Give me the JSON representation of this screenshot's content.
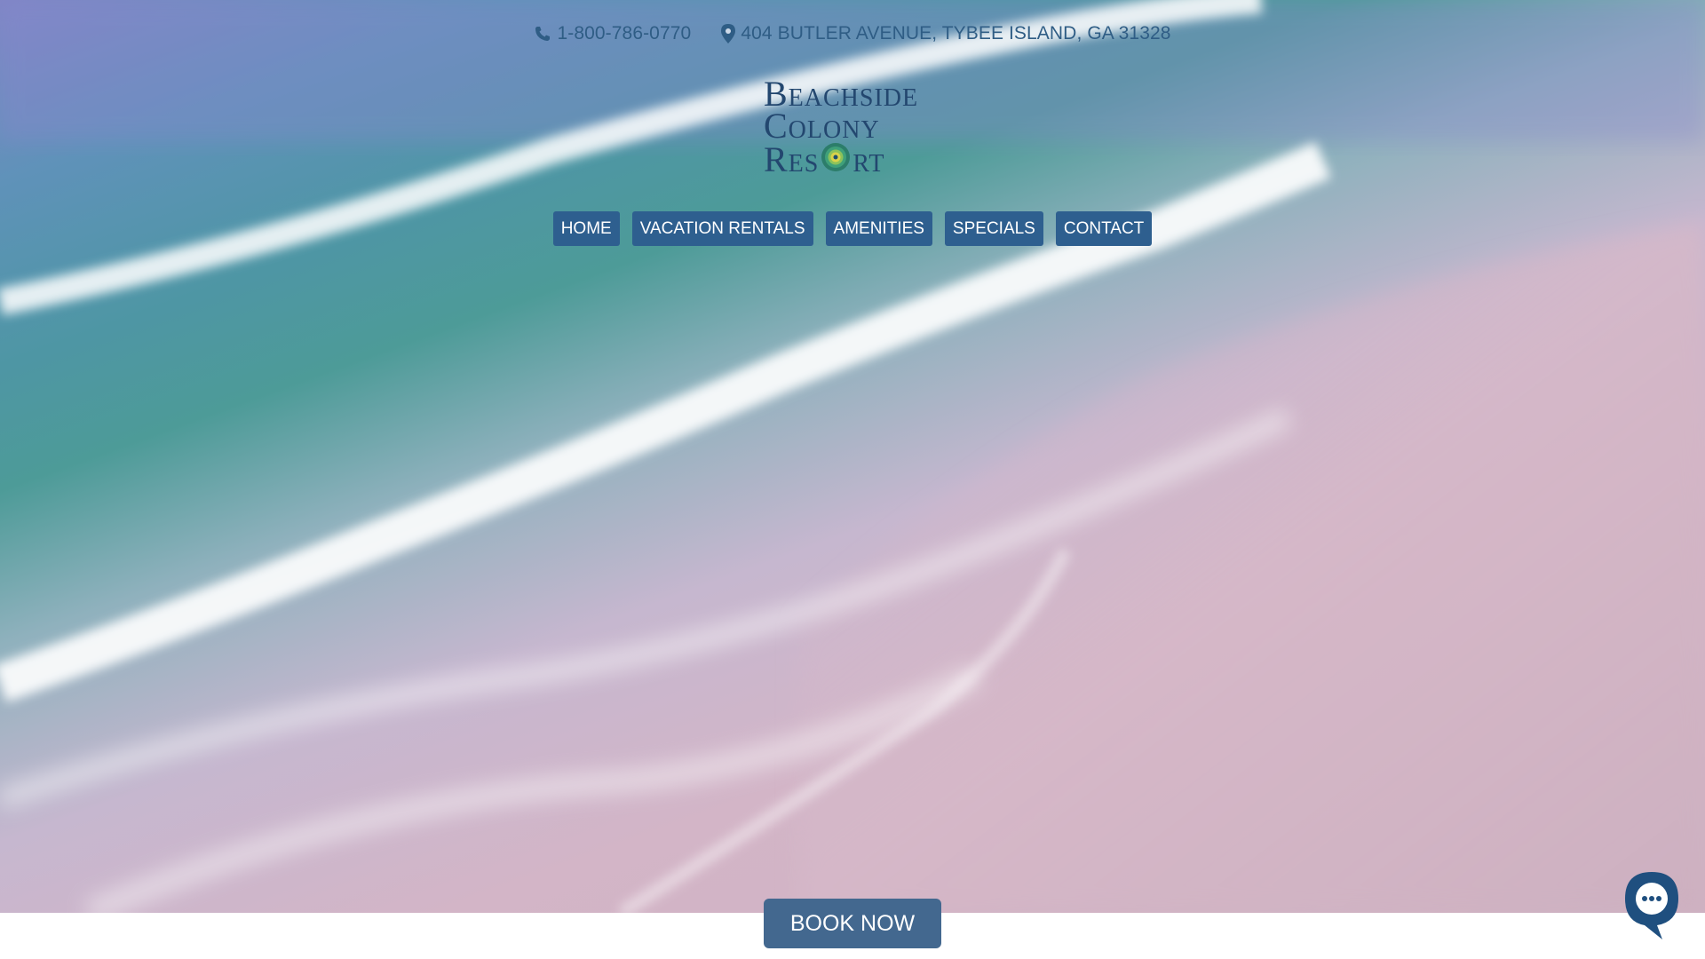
{
  "contact": {
    "phone": "1-800-786-0770",
    "address": "404 BUTLER AVENUE, TYBEE ISLAND, GA 31328",
    "phone_icon": "phone-icon",
    "address_icon": "map-pin-icon"
  },
  "logo": {
    "line1": "Beachside",
    "line2": "Colony",
    "line3_a": "Res",
    "line3_b": "rt",
    "icon": "nautilus-shell-icon"
  },
  "nav": {
    "home": "HOME",
    "vacation_rentals": "VACATION RENTALS",
    "amenities": "AMENITIES",
    "specials": "SPECIALS",
    "contact": "CONTACT"
  },
  "book_now": "BOOK NOW",
  "chat_icon": "chat-bubble-icon",
  "colors": {
    "nav_bg": "#2e5f8f",
    "text_blue": "#2f5d85",
    "book_bg": "#43688f",
    "chat_bg": "#1f4f7f"
  }
}
